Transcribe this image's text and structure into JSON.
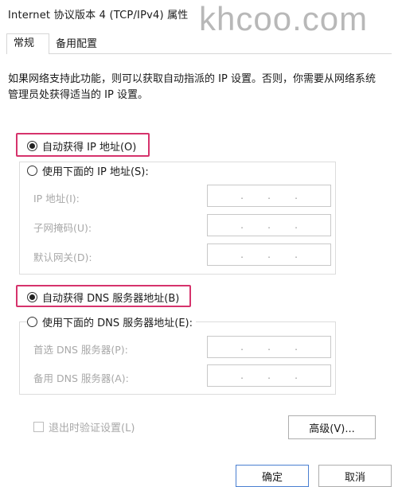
{
  "window": {
    "title": "Internet 协议版本 4 (TCP/IPv4) 属性"
  },
  "watermark": "khcoo.com",
  "tabs": [
    {
      "label": "常规"
    },
    {
      "label": "备用配置"
    }
  ],
  "general": {
    "description": "如果网络支持此功能，则可以获取自动指派的 IP 设置。否则，你需要从网络系统管理员处获得适当的 IP 设置。",
    "ip": {
      "auto_label": "自动获得 IP 地址(O)",
      "manual_label": "使用下面的 IP 地址(S):",
      "auto_selected": true,
      "fields": [
        {
          "label": "IP 地址(I):",
          "value": ".   .   ."
        },
        {
          "label": "子网掩码(U):",
          "value": ".   .   ."
        },
        {
          "label": "默认网关(D):",
          "value": ".   .   ."
        }
      ]
    },
    "dns": {
      "auto_label": "自动获得 DNS 服务器地址(B)",
      "manual_label": "使用下面的 DNS 服务器地址(E):",
      "auto_selected": true,
      "fields": [
        {
          "label": "首选 DNS 服务器(P):",
          "value": ".   .   ."
        },
        {
          "label": "备用 DNS 服务器(A):",
          "value": ".   .   ."
        }
      ]
    },
    "validate_label": "退出时验证设置(L)",
    "advanced_label": "高级(V)..."
  },
  "footer": {
    "ok_label": "确定",
    "cancel_label": "取消"
  },
  "colors": {
    "highlight": "#d6336c",
    "primary_border": "#4a7fd1"
  }
}
